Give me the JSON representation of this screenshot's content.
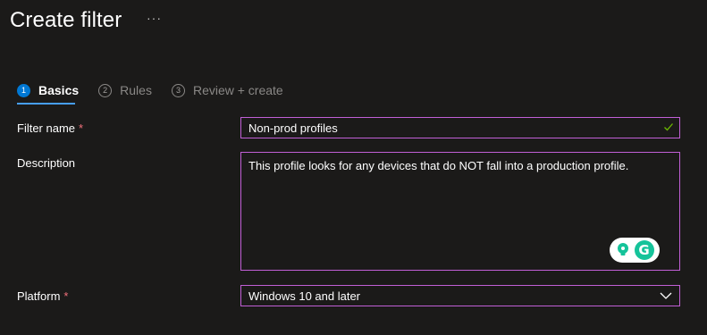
{
  "header": {
    "title": "Create filter",
    "more_label": "···"
  },
  "steps": [
    {
      "number": "1",
      "label": "Basics",
      "active": true
    },
    {
      "number": "2",
      "label": "Rules",
      "active": false
    },
    {
      "number": "3",
      "label": "Review + create",
      "active": false
    }
  ],
  "form": {
    "filter_name": {
      "label": "Filter name",
      "required_mark": "*",
      "value": "Non-prod profiles",
      "status_icon": "checkmark-icon"
    },
    "description": {
      "label": "Description",
      "value": "This profile looks for any devices that do NOT fall into a production profile."
    },
    "platform": {
      "label": "Platform",
      "required_mark": "*",
      "selected": "Windows 10 and later"
    }
  },
  "grammarly": {
    "logo_letter": "G",
    "icons": [
      "lightbulb-icon",
      "grammarly-icon"
    ]
  },
  "colors": {
    "background": "#1b1a19",
    "accent": "#0078d4",
    "focus_border": "#c15fd6",
    "required": "#f1707b",
    "valid": "#6bb700",
    "grammarly": "#15c39a"
  }
}
